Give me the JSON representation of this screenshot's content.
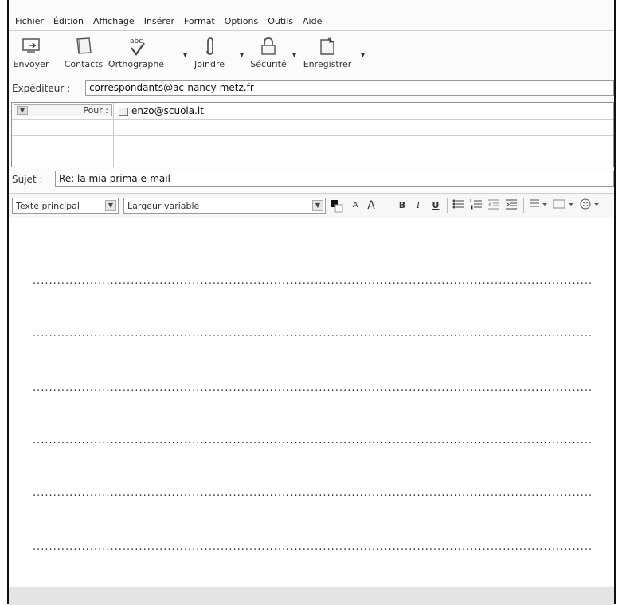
{
  "menu": {
    "items": [
      {
        "u": "F",
        "rest": "ichier"
      },
      {
        "u": "",
        "pre": "Éditio",
        "u2": "n"
      },
      {
        "u": "A",
        "rest": "ffichage"
      },
      {
        "u": "I",
        "rest": "nsérer"
      },
      {
        "pre": "F",
        "u2": "o",
        "rest2": "rmat"
      },
      {
        "pre": "Op",
        "u2": "t",
        "rest2": "ions"
      },
      {
        "u": "O",
        "rest": "utils"
      },
      {
        "pre": "Aid",
        "u2": "e"
      }
    ],
    "labels": [
      "Fichier",
      "Édition",
      "Affichage",
      "Insérer",
      "Format",
      "Options",
      "Outils",
      "Aide"
    ]
  },
  "toolbar": {
    "send": "Envoyer",
    "contacts": "Contacts",
    "spelling": "Orthographe",
    "spelling_icon_text": "abc",
    "attach": "Joindre",
    "security": "Sécurité",
    "save": "Enregistrer",
    "dropdown_glyph": "▾"
  },
  "header": {
    "from_label": "Expéditeur :",
    "from_value": "correspondants@ac-nancy-metz.fr",
    "recipient_type": "Pour :",
    "recipient_value": "enzo@scuola.it",
    "subject_label": "Sujet :",
    "subject_value": "Re: la mia prima e-mail"
  },
  "format_bar": {
    "paragraph_style": "Texte principal",
    "font": "Largeur variable",
    "smaller": "A",
    "larger": "A",
    "bold": "B",
    "italic": "I",
    "underline": "U"
  },
  "body": {
    "dotted_lines": 6,
    "dots": "...................................................................................................................................................................."
  },
  "colors": {
    "frame": "#111111",
    "field_border": "#9a9a9a"
  }
}
